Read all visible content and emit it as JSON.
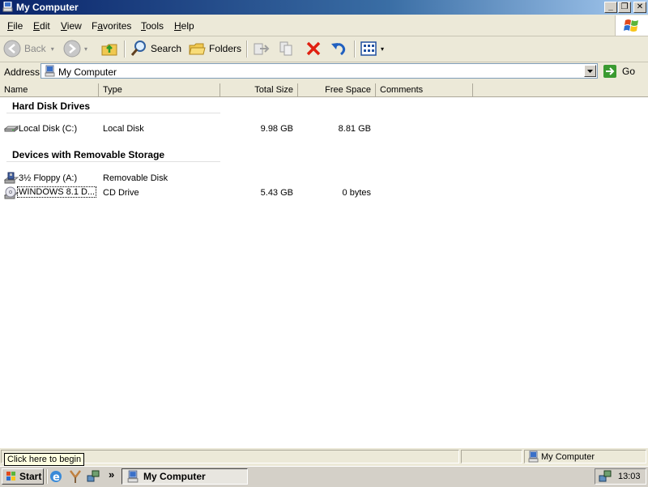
{
  "window": {
    "title": "My Computer",
    "minimize_glyph": "_",
    "maximize_glyph": "❐",
    "close_glyph": "✕"
  },
  "menu": [
    "File",
    "Edit",
    "View",
    "Favorites",
    "Tools",
    "Help"
  ],
  "menu_accel": [
    "F",
    "E",
    "V",
    "a",
    "T",
    "H"
  ],
  "toolbar": {
    "back_label": "Back",
    "search_label": "Search",
    "folders_label": "Folders"
  },
  "address": {
    "label": "Address",
    "value": "My Computer",
    "go_label": "Go"
  },
  "columns": [
    "Name",
    "Type",
    "Total Size",
    "Free Space",
    "Comments"
  ],
  "groups": [
    {
      "title": "Hard Disk Drives",
      "items": [
        {
          "name": "Local Disk (C:)",
          "type": "Local Disk",
          "total": "9.98 GB",
          "free": "8.81 GB",
          "icon": "hard-drive-icon"
        }
      ]
    },
    {
      "title": "Devices with Removable Storage",
      "items": [
        {
          "name": "3½ Floppy (A:)",
          "type": "Removable Disk",
          "total": "",
          "free": "",
          "icon": "floppy-drive-icon"
        },
        {
          "name": "WINDOWS 8.1 D...",
          "type": "CD Drive",
          "total": "5.43 GB",
          "free": "0 bytes",
          "icon": "cd-drive-icon"
        }
      ]
    }
  ],
  "status": {
    "tooltip": "Click here to begin",
    "zone": "My Computer"
  },
  "taskbar": {
    "start_label": "Start",
    "chevron": "»",
    "task_label": "My Computer",
    "clock": "13:03"
  }
}
